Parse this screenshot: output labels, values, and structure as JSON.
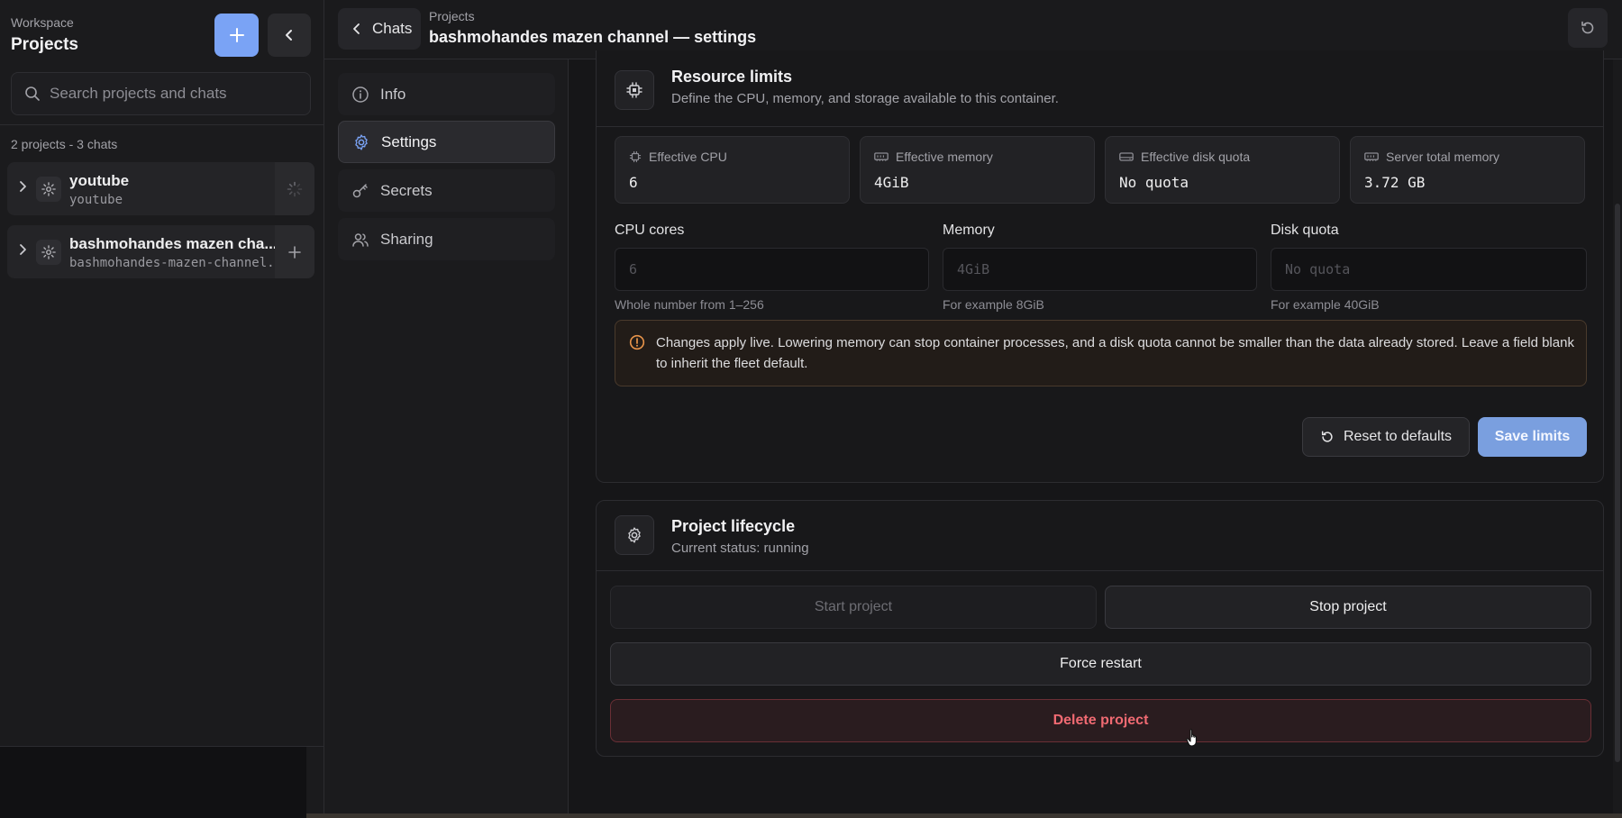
{
  "sidebar": {
    "workspace_label": "Workspace",
    "title": "Projects",
    "search_placeholder": "Search projects and chats",
    "count": "2 projects - 3 chats",
    "projects": [
      {
        "name": "youtube",
        "slug": "youtube"
      },
      {
        "name": "bashmohandes mazen cha...",
        "slug": "bashmohandes-mazen-channel..."
      }
    ]
  },
  "header": {
    "back_label": "Chats",
    "breadcrumb": "Projects",
    "title": "bashmohandes mazen channel — settings"
  },
  "settings_nav": {
    "items": [
      {
        "label": "Info",
        "icon": "info-icon"
      },
      {
        "label": "Settings",
        "icon": "gear-icon"
      },
      {
        "label": "Secrets",
        "icon": "key-icon"
      },
      {
        "label": "Sharing",
        "icon": "users-icon"
      }
    ],
    "active": "Settings"
  },
  "resource_limits": {
    "title": "Resource limits",
    "subtitle": "Define the CPU, memory, and storage available to this container.",
    "stats": [
      {
        "label": "Effective CPU",
        "value": "6",
        "icon": "cpu-icon"
      },
      {
        "label": "Effective memory",
        "value": "4GiB",
        "icon": "memory-icon"
      },
      {
        "label": "Effective disk quota",
        "value": "No quota",
        "icon": "disk-icon"
      },
      {
        "label": "Server total memory",
        "value": "3.72 GB",
        "icon": "memory-icon"
      }
    ],
    "fields": [
      {
        "label": "CPU cores",
        "placeholder": "6",
        "hint": "Whole number from 1–256"
      },
      {
        "label": "Memory",
        "placeholder": "4GiB",
        "hint": "For example 8GiB"
      },
      {
        "label": "Disk quota",
        "placeholder": "No quota",
        "hint": "For example 40GiB"
      }
    ],
    "warning": "Changes apply live. Lowering memory can stop container processes, and a disk quota cannot be smaller than the data already stored. Leave a field blank to inherit the fleet default.",
    "reset_label": "Reset to defaults",
    "save_label": "Save limits"
  },
  "lifecycle": {
    "title": "Project lifecycle",
    "status": "Current status: running",
    "start_label": "Start project",
    "stop_label": "Stop project",
    "force_label": "Force restart",
    "delete_label": "Delete project"
  },
  "colors": {
    "accent": "#7aa3f5",
    "save": "#7a9fdf",
    "danger": "#f06a72",
    "warning": "#e8944a"
  }
}
